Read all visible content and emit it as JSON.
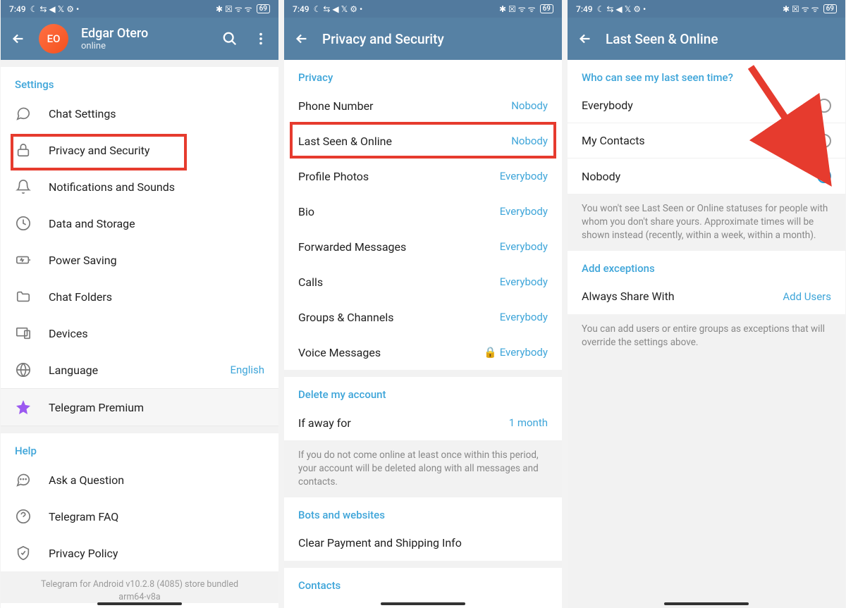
{
  "status": {
    "time": "7:49",
    "battery": "69"
  },
  "phone1": {
    "avatar_initials": "EO",
    "profile_name": "Edgar Otero",
    "profile_status": "online",
    "section_settings": "Settings",
    "items": [
      {
        "label": "Chat Settings"
      },
      {
        "label": "Privacy and Security"
      },
      {
        "label": "Notifications and Sounds"
      },
      {
        "label": "Data and Storage"
      },
      {
        "label": "Power Saving"
      },
      {
        "label": "Chat Folders"
      },
      {
        "label": "Devices"
      },
      {
        "label": "Language",
        "value": "English"
      }
    ],
    "premium_label": "Telegram Premium",
    "section_help": "Help",
    "help_items": [
      {
        "label": "Ask a Question"
      },
      {
        "label": "Telegram FAQ"
      },
      {
        "label": "Privacy Policy"
      }
    ],
    "version": "Telegram for Android v10.2.8 (4085) store bundled\narm64-v8a"
  },
  "phone2": {
    "title": "Privacy and Security",
    "section_privacy": "Privacy",
    "privacy_items": [
      {
        "label": "Phone Number",
        "value": "Nobody"
      },
      {
        "label": "Last Seen & Online",
        "value": "Nobody"
      },
      {
        "label": "Profile Photos",
        "value": "Everybody"
      },
      {
        "label": "Bio",
        "value": "Everybody"
      },
      {
        "label": "Forwarded Messages",
        "value": "Everybody"
      },
      {
        "label": "Calls",
        "value": "Everybody"
      },
      {
        "label": "Groups & Channels",
        "value": "Everybody"
      },
      {
        "label": "Voice Messages",
        "value": "Everybody",
        "locked": true
      }
    ],
    "section_delete": "Delete my account",
    "delete_item": {
      "label": "If away for",
      "value": "1 month"
    },
    "delete_info": "If you do not come online at least once within this period, your account will be deleted along with all messages and contacts.",
    "section_bots": "Bots and websites",
    "bots_item": {
      "label": "Clear Payment and Shipping Info"
    },
    "section_contacts": "Contacts"
  },
  "phone3": {
    "title": "Last Seen & Online",
    "section_who": "Who can see my last seen time?",
    "options": [
      {
        "label": "Everybody",
        "selected": false
      },
      {
        "label": "My Contacts",
        "selected": false
      },
      {
        "label": "Nobody",
        "selected": true
      }
    ],
    "who_info": "You won't see Last Seen or Online statuses for people with whom you don't share yours. Approximate times will be shown instead (recently, within a week, within a month).",
    "section_exceptions": "Add exceptions",
    "exception_item": {
      "label": "Always Share With",
      "value": "Add Users"
    },
    "exception_info": "You can add users or entire groups as exceptions that will override the settings above."
  }
}
